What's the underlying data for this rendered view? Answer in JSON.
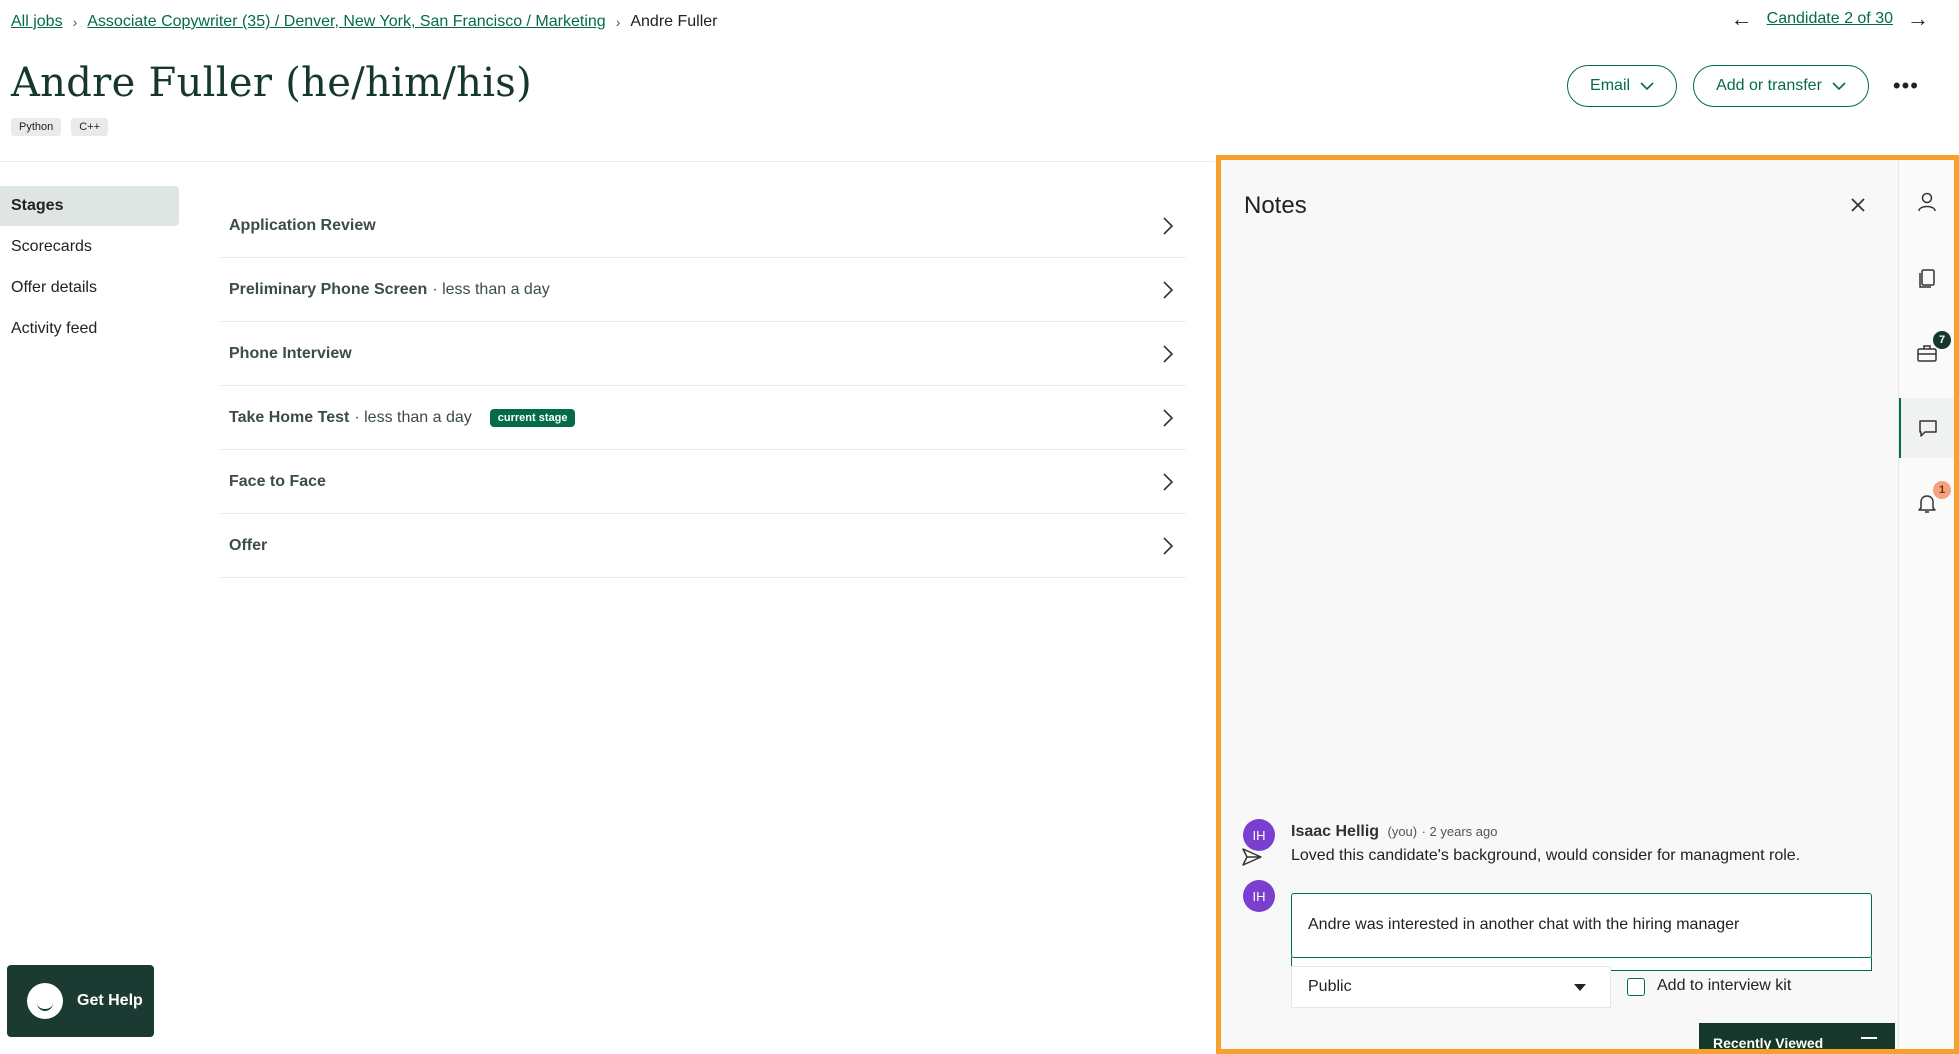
{
  "breadcrumb": {
    "all_jobs": "All jobs",
    "job": "Associate Copywriter (35) / Denver, New York, San Francisco / Marketing",
    "current": "Andre Fuller"
  },
  "candidate_nav": {
    "label": "Candidate 2 of 30"
  },
  "candidate": {
    "name": "Andre Fuller  (he/him/his)",
    "tags": [
      "Python",
      "C++"
    ]
  },
  "actions": {
    "email": "Email",
    "add_transfer": "Add or transfer",
    "more": "•••"
  },
  "left_nav": [
    "Stages",
    "Scorecards",
    "Offer details",
    "Activity feed"
  ],
  "stages": [
    {
      "name": "Application Review",
      "meta": "",
      "badge": ""
    },
    {
      "name": "Preliminary Phone Screen",
      "meta": "· less than a day",
      "badge": ""
    },
    {
      "name": "Phone Interview",
      "meta": "",
      "badge": ""
    },
    {
      "name": "Take Home Test",
      "meta": "· less than a day",
      "badge": "current stage"
    },
    {
      "name": "Face to Face",
      "meta": "",
      "badge": ""
    },
    {
      "name": "Offer",
      "meta": "",
      "badge": ""
    }
  ],
  "get_help": "Get Help",
  "notes": {
    "title": "Notes",
    "note": {
      "initials": "IH",
      "author": "Isaac Hellig",
      "you": "(you)",
      "time": "· 2 years ago",
      "body": "Loved this candidate's background, would consider for managment role."
    },
    "composer": {
      "initials": "IH",
      "value": "Andre was interested in another chat with the hiring manager",
      "visibility": "Public",
      "kit_label": "Add to interview kit"
    }
  },
  "rail": {
    "jobs_badge": "7",
    "alerts_badge": "1"
  },
  "recently_viewed": "Recently Viewed",
  "colors": {
    "accent": "#046b4a",
    "dark": "#15372c",
    "highlight": "#f5a12c",
    "avatar": "#7b3fd0"
  }
}
